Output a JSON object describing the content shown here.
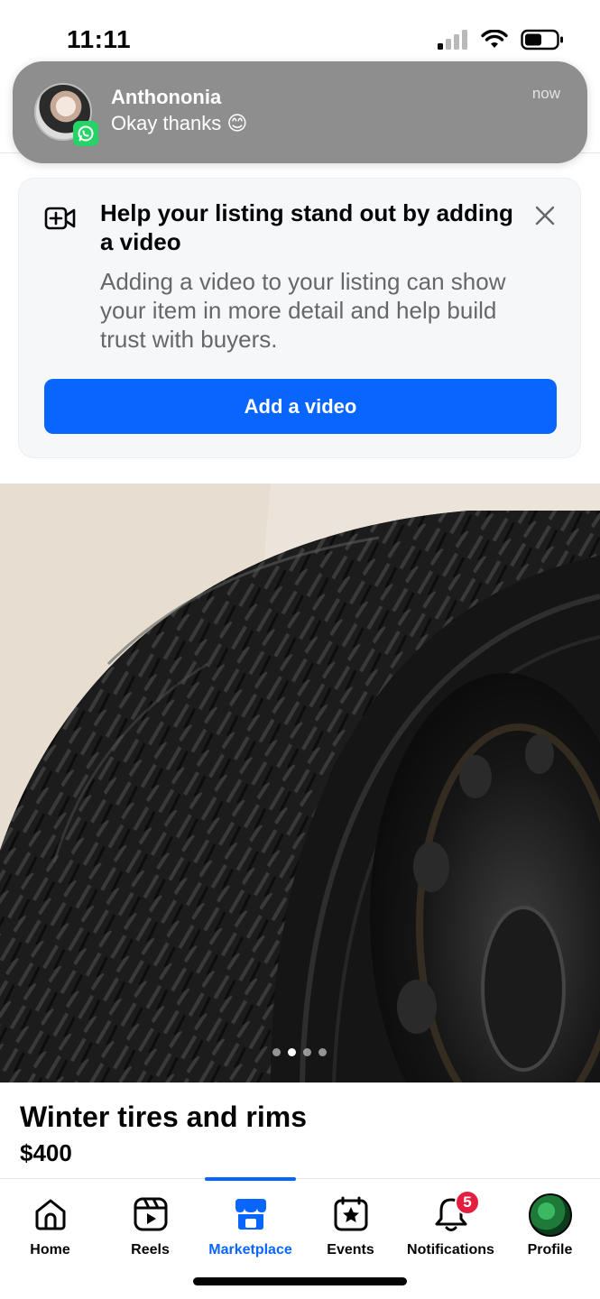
{
  "status_bar": {
    "time": "11:11"
  },
  "notification": {
    "sender": "Anthononia",
    "message": "Okay thanks 😊",
    "time": "now",
    "app_icon": "whatsapp-icon"
  },
  "video_prompt": {
    "title": "Help your listing stand out by adding a video",
    "body": "Adding a video to your listing can show your item in more detail and help build trust with buyers.",
    "button_label": "Add a video",
    "accent_color": "#0866ff"
  },
  "listing": {
    "title": "Winter tires and rims",
    "price": "$400",
    "photo_count": 4,
    "active_photo_index": 1
  },
  "bottom_nav": {
    "items": [
      {
        "label": "Home",
        "icon": "home-icon"
      },
      {
        "label": "Reels",
        "icon": "reels-icon"
      },
      {
        "label": "Marketplace",
        "icon": "marketplace-icon",
        "active": true
      },
      {
        "label": "Events",
        "icon": "events-icon"
      },
      {
        "label": "Notifications",
        "icon": "bell-icon",
        "badge": "5"
      },
      {
        "label": "Profile",
        "icon": "profile-avatar"
      }
    ]
  }
}
